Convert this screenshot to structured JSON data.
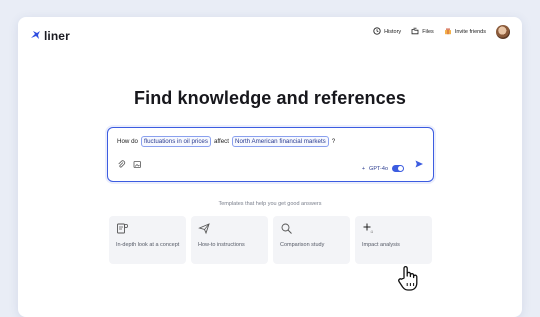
{
  "app": {
    "logo_text": "liner"
  },
  "nav": {
    "history_label": "History",
    "files_label": "Files",
    "invite_label": "Invite friends"
  },
  "headline": "Find knowledge and references",
  "search": {
    "query_prefix": "How do",
    "chip1": "fluctuations in oil prices",
    "query_mid": "affect",
    "chip2": "North American financial markets",
    "query_suffix": "?",
    "model_label": "GPT-4o",
    "model_toggle_on": true
  },
  "templates": {
    "title": "Templates that help you get good answers",
    "cards": [
      {
        "label": "In-depth look at a concept",
        "icon": "document-search-icon"
      },
      {
        "label": "How-to instructions",
        "icon": "paper-plane-icon"
      },
      {
        "label": "Comparison study",
        "icon": "magnifier-icon"
      },
      {
        "label": "Impact analysis",
        "icon": "sparkle-icon"
      }
    ]
  },
  "colors": {
    "accent": "#3c5ce0",
    "background": "#e9edf6"
  }
}
